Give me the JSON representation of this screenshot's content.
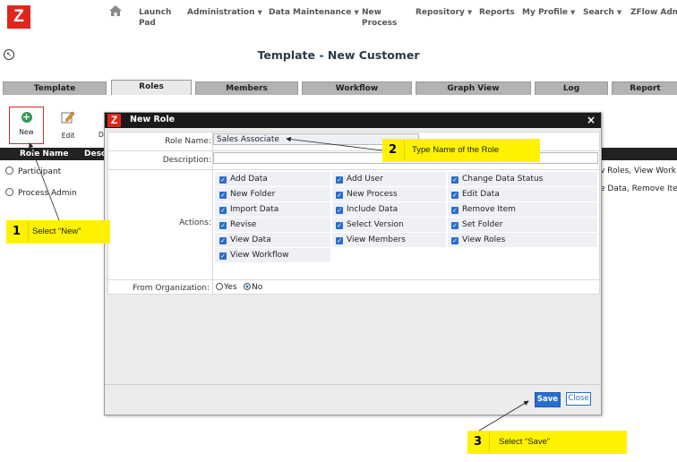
{
  "app": {
    "logo": "Z"
  },
  "nav": {
    "items": [
      {
        "label_line1": "Launch",
        "label_line2": "Pad",
        "has_caret": false
      },
      {
        "label_line1": "Administration",
        "label_line2": "",
        "has_caret": true
      },
      {
        "label_line1": "Data Maintenance",
        "label_line2": "",
        "has_caret": true
      },
      {
        "label_line1": "New",
        "label_line2": "Process",
        "has_caret": false
      },
      {
        "label_line1": "Repository",
        "label_line2": "",
        "has_caret": true
      },
      {
        "label_line1": "Reports",
        "label_line2": "",
        "has_caret": false
      },
      {
        "label_line1": "My Profile",
        "label_line2": "",
        "has_caret": true
      },
      {
        "label_line1": "Search",
        "label_line2": "",
        "has_caret": true
      },
      {
        "label_line1": "ZFlow Adm",
        "label_line2": "",
        "has_caret": false
      }
    ]
  },
  "page": {
    "title": "Template - New Customer"
  },
  "tabs": [
    {
      "label": "Template",
      "active": false
    },
    {
      "label": "Roles",
      "active": true
    },
    {
      "label": "Members",
      "active": false
    },
    {
      "label": "Workflow",
      "active": false
    },
    {
      "label": "Graph View",
      "active": false
    },
    {
      "label": "Log",
      "active": false
    },
    {
      "label": "Report",
      "active": false
    }
  ],
  "toolbar": {
    "new_label": "New",
    "edit_label": "Edit",
    "partial_label": "D"
  },
  "roles_table": {
    "headers": [
      "Role Name",
      "Desc"
    ],
    "rows": [
      {
        "name": "Participant",
        "right_fragment": "v Roles, View Work"
      },
      {
        "name": "Process Admin",
        "right_fragment": "e Data, Remove Ite"
      }
    ]
  },
  "modal": {
    "logo": "Z",
    "title": "New Role",
    "close_glyph": "×",
    "role_name_label": "Role Name:",
    "role_name_value": "Sales Associate",
    "description_label": "Description:",
    "description_value": "",
    "actions_label": "Actions:",
    "actions": [
      [
        "Add Data",
        "Add User",
        "Change Data Status"
      ],
      [
        "New Folder",
        "New Process",
        "Edit Data"
      ],
      [
        "Import Data",
        "Include Data",
        "Remove Item"
      ],
      [
        "Revise",
        "Select Version",
        "Set Folder"
      ],
      [
        "View Data",
        "View Members",
        "View Roles"
      ],
      [
        "View Workflow"
      ]
    ],
    "org_label": "From Organization:",
    "org_yes": "Yes",
    "org_no": "No",
    "org_selected": "No",
    "save_label": "Save",
    "close_label": "Close"
  },
  "callouts": [
    {
      "num": "1",
      "text": "Select “New”"
    },
    {
      "num": "2",
      "text": "Type Name of the Role"
    },
    {
      "num": "3",
      "text": "Select “Save”"
    }
  ],
  "colors": {
    "logo_red": "#e0261c",
    "accent_blue": "#2a6ecb",
    "callout_yellow": "#fff200",
    "checkbox_blue": "#2a6ecb"
  }
}
